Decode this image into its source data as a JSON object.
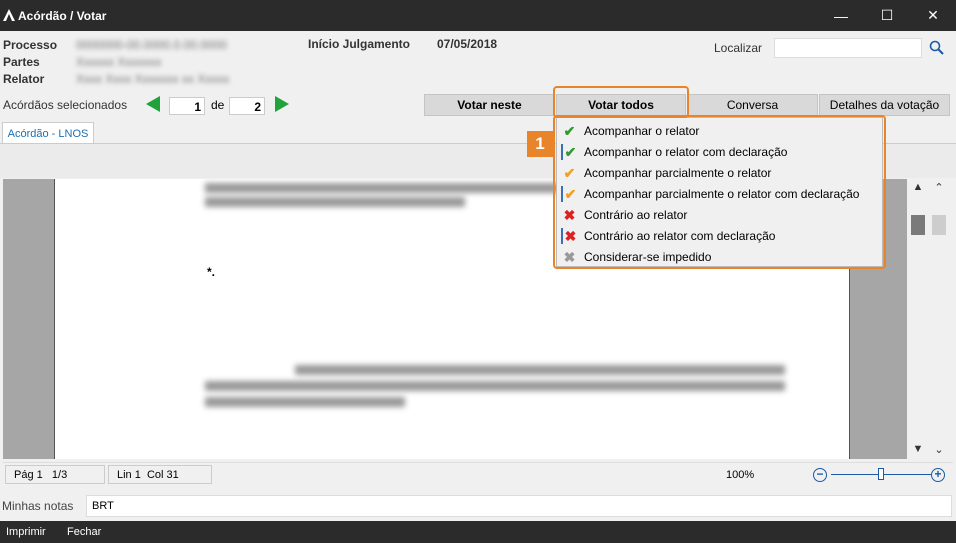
{
  "window": {
    "title": "Acórdão / Votar",
    "minimize": "—",
    "maximize": "☐",
    "close": "✕"
  },
  "header": {
    "processo_label": "Processo",
    "partes_label": "Partes",
    "relator_label": "Relator",
    "processo_value": "0000000-00.0000.0.00.0000",
    "partes_value": "Xxxxxx Xxxxxxx",
    "relator_value": "Xxxx Xxxx Xxxxxxx xx Xxxxx",
    "inicio_label": "Início Julgamento",
    "inicio_value": "07/05/2018",
    "localizar_label": "Localizar",
    "localizar_value": "",
    "acordaos_label": "Acórdãos selecionados",
    "current_page": "1",
    "de_label": "de",
    "total_pages": "2"
  },
  "vote_buttons": {
    "votar_neste": "Votar neste",
    "votar_todos": "Votar todos",
    "conversa": "Conversa",
    "detalhes": "Detalhes da votação"
  },
  "tabs": {
    "active": "Acórdão - LNOS"
  },
  "dropdown": {
    "badge": "1",
    "items": [
      {
        "label": "Acompanhar o relator",
        "icon": "check-icon",
        "color": "#2e9b2e"
      },
      {
        "label": "Acompanhar o relator com declaração",
        "icon": "check-doc-icon",
        "color": "#2e9b2e"
      },
      {
        "label": "Acompanhar parcialmente o relator",
        "icon": "partial-check-icon",
        "color": "#f0a020"
      },
      {
        "label": "Acompanhar parcialmente o relator com declaração",
        "icon": "partial-check-doc-icon",
        "color": "#f0a020"
      },
      {
        "label": "Contrário ao relator",
        "icon": "x-icon",
        "color": "#e02020"
      },
      {
        "label": "Contrário ao relator com declaração",
        "icon": "x-doc-icon",
        "color": "#e02020"
      },
      {
        "label": "Considerar-se impedido",
        "icon": "gray-x-icon",
        "color": "#999999"
      }
    ]
  },
  "document": {
    "marker": "*."
  },
  "statusbar": {
    "page": "Pág 1",
    "page_of": "1/3",
    "line": "Lin 1",
    "col": "Col 31",
    "zoom": "100%",
    "zoom_level": 0.5
  },
  "notes": {
    "label": "Minhas notas",
    "value": "BRT"
  },
  "bottom": {
    "imprimir": "Imprimir",
    "fechar": "Fechar"
  },
  "colors": {
    "accent_orange": "#e8842a",
    "link_blue": "#1a6fb3",
    "nav_green": "#1fa33a"
  }
}
